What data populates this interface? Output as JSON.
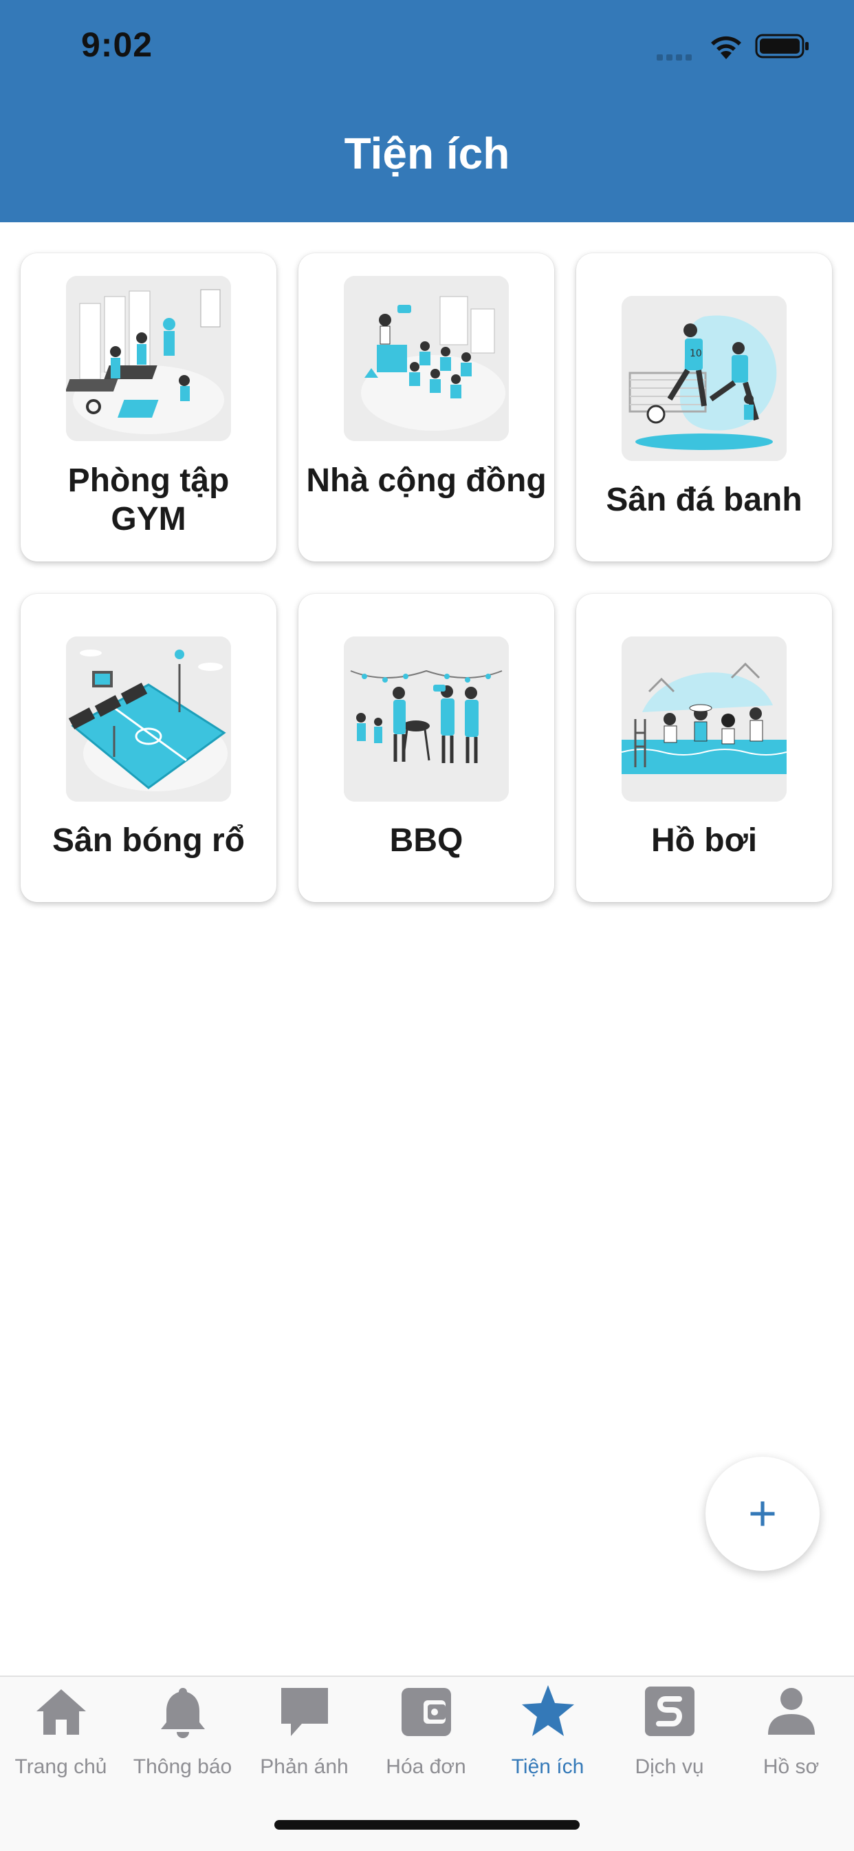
{
  "status_bar": {
    "time": "9:02"
  },
  "header": {
    "title": "Tiện ích"
  },
  "utilities": [
    {
      "label": "Phòng tập GYM",
      "icon": "gym-illustration"
    },
    {
      "label": "Nhà cộng đồng",
      "icon": "community-house-illustration"
    },
    {
      "label": "Sân đá banh",
      "icon": "soccer-field-illustration"
    },
    {
      "label": "Sân bóng rổ",
      "icon": "basketball-court-illustration"
    },
    {
      "label": "BBQ",
      "icon": "bbq-illustration"
    },
    {
      "label": "Hồ bơi",
      "icon": "swimming-pool-illustration"
    }
  ],
  "fab": {
    "symbol": "+",
    "icon": "plus-icon"
  },
  "tabbar": {
    "items": [
      {
        "label": "Trang chủ",
        "icon": "home-icon"
      },
      {
        "label": "Thông báo",
        "icon": "bell-icon"
      },
      {
        "label": "Phản ánh",
        "icon": "chat-bubble-icon"
      },
      {
        "label": "Hóa đơn",
        "icon": "wallet-icon"
      },
      {
        "label": "Tiện ích",
        "icon": "star-icon",
        "active": true
      },
      {
        "label": "Dịch vụ",
        "icon": "service-icon"
      },
      {
        "label": "Hồ sơ",
        "icon": "person-icon"
      }
    ]
  },
  "colors": {
    "primary": "#3479b8",
    "accent_illustration": "#3cc3de",
    "inactive_tab": "#8e8e93"
  }
}
